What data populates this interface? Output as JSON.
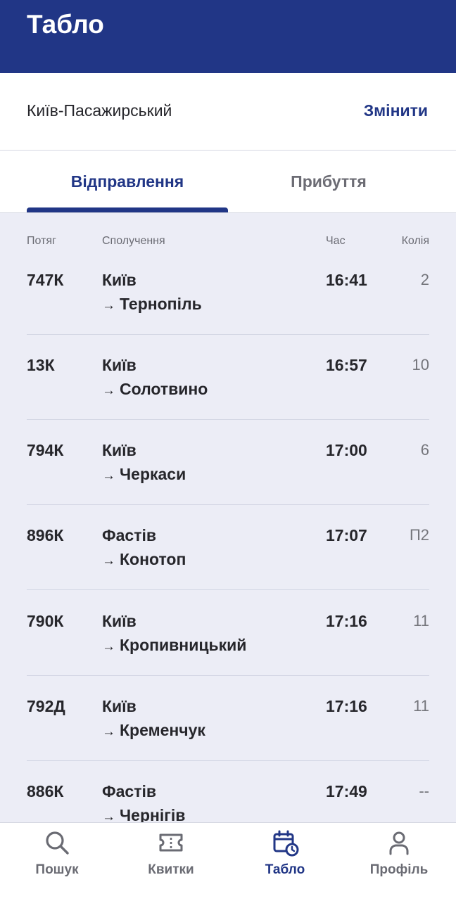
{
  "header": {
    "title": "Табло"
  },
  "station": {
    "name": "Київ-Пасажирський",
    "change_label": "Змінити"
  },
  "tabs": [
    {
      "label": "Відправлення",
      "active": true
    },
    {
      "label": "Прибуття",
      "active": false
    }
  ],
  "columns": {
    "train": "Потяг",
    "route": "Сполучення",
    "time": "Час",
    "track": "Колія"
  },
  "rows": [
    {
      "train": "747К",
      "from": "Київ",
      "to": "Тернопіль",
      "time": "16:41",
      "track": "2"
    },
    {
      "train": "13К",
      "from": "Київ",
      "to": "Солотвино",
      "time": "16:57",
      "track": "10"
    },
    {
      "train": "794К",
      "from": "Київ",
      "to": "Черкаси",
      "time": "17:00",
      "track": "6"
    },
    {
      "train": "896К",
      "from": "Фастів",
      "to": "Конотоп",
      "time": "17:07",
      "track": "П2"
    },
    {
      "train": "790К",
      "from": "Київ",
      "to": "Кропивницький",
      "time": "17:16",
      "track": "11"
    },
    {
      "train": "792Д",
      "from": "Київ",
      "to": "Кременчук",
      "time": "17:16",
      "track": "11"
    },
    {
      "train": "886К",
      "from": "Фастів",
      "to": "Чернігів",
      "time": "17:49",
      "track": "--"
    }
  ],
  "route_arrow": "→",
  "nav": [
    {
      "label": "Пошук",
      "icon": "search-icon",
      "active": false
    },
    {
      "label": "Квитки",
      "icon": "ticket-icon",
      "active": false
    },
    {
      "label": "Табло",
      "icon": "calendar-clock-icon",
      "active": true
    },
    {
      "label": "Профіль",
      "icon": "profile-icon",
      "active": false
    }
  ],
  "colors": {
    "primary": "#213686",
    "board_bg": "#ecedf6",
    "muted": "#6a6b73"
  }
}
